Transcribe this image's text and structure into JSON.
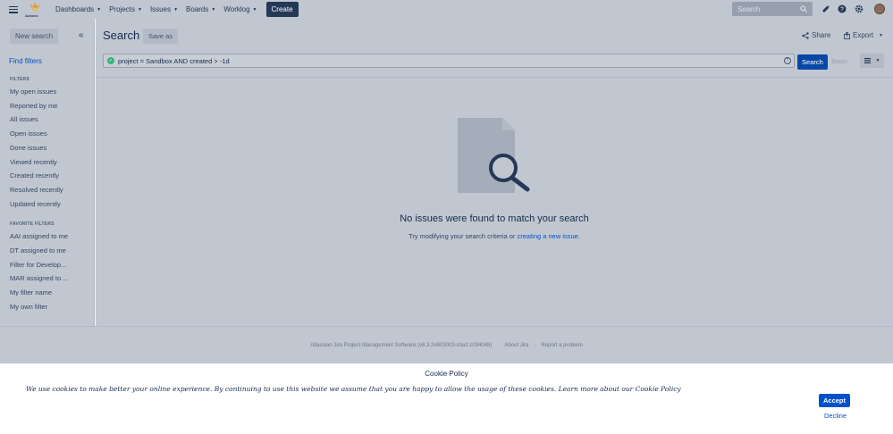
{
  "header": {
    "logo_text": "Actonic",
    "nav": [
      {
        "label": "Dashboards"
      },
      {
        "label": "Projects"
      },
      {
        "label": "Issues"
      },
      {
        "label": "Boards"
      },
      {
        "label": "Worklog"
      }
    ],
    "create_label": "Create",
    "search_placeholder": "Search"
  },
  "sidebar": {
    "new_search_label": "New search",
    "find_filters_label": "Find filters",
    "filters_title": "FILTERS",
    "filters": [
      {
        "label": "My open issues"
      },
      {
        "label": "Reported by me"
      },
      {
        "label": "All issues"
      },
      {
        "label": "Open issues"
      },
      {
        "label": "Done issues"
      },
      {
        "label": "Viewed recently"
      },
      {
        "label": "Created recently"
      },
      {
        "label": "Resolved recently"
      },
      {
        "label": "Updated recently"
      }
    ],
    "favorites_title": "FAVORITE FILTERS",
    "favorites": [
      {
        "label": "AAI assigned to me"
      },
      {
        "label": "DT assigned to me"
      },
      {
        "label": "Filter for Develop..."
      },
      {
        "label": "MAR assigned to ..."
      },
      {
        "label": "My filter name"
      },
      {
        "label": "My own filter"
      }
    ]
  },
  "main": {
    "title": "Search",
    "save_as_label": "Save as",
    "share_label": "Share",
    "export_label": "Export",
    "jql_query": "project = Sandbox AND created > -1d",
    "search_button_label": "Search",
    "basic_label": "Basic",
    "empty_title": "No issues were found to match your search",
    "empty_sub_text": "Try modifying your search criteria or ",
    "empty_sub_link": "creating a new issue",
    "empty_sub_end": "."
  },
  "footer": {
    "product": "Atlassian Jira Project Management Software (v8.3.2#803003-sha1:c034048)",
    "sep1": "·",
    "about": "About Jira",
    "sep2": "·",
    "report": "Report a problem"
  },
  "cookie": {
    "title": "Cookie Policy",
    "text": "We use cookies to make better your online experience. By continuing to use this website we assume that you are happy to allow the usage of these cookies. Learn more about our Cookie Policy",
    "accept_label": "Accept",
    "decline_label": "Decline"
  },
  "colors": {
    "primary": "#0052cc",
    "header_dark": "#253858",
    "success": "#36b37e",
    "overlay": "#c1c7d0"
  }
}
